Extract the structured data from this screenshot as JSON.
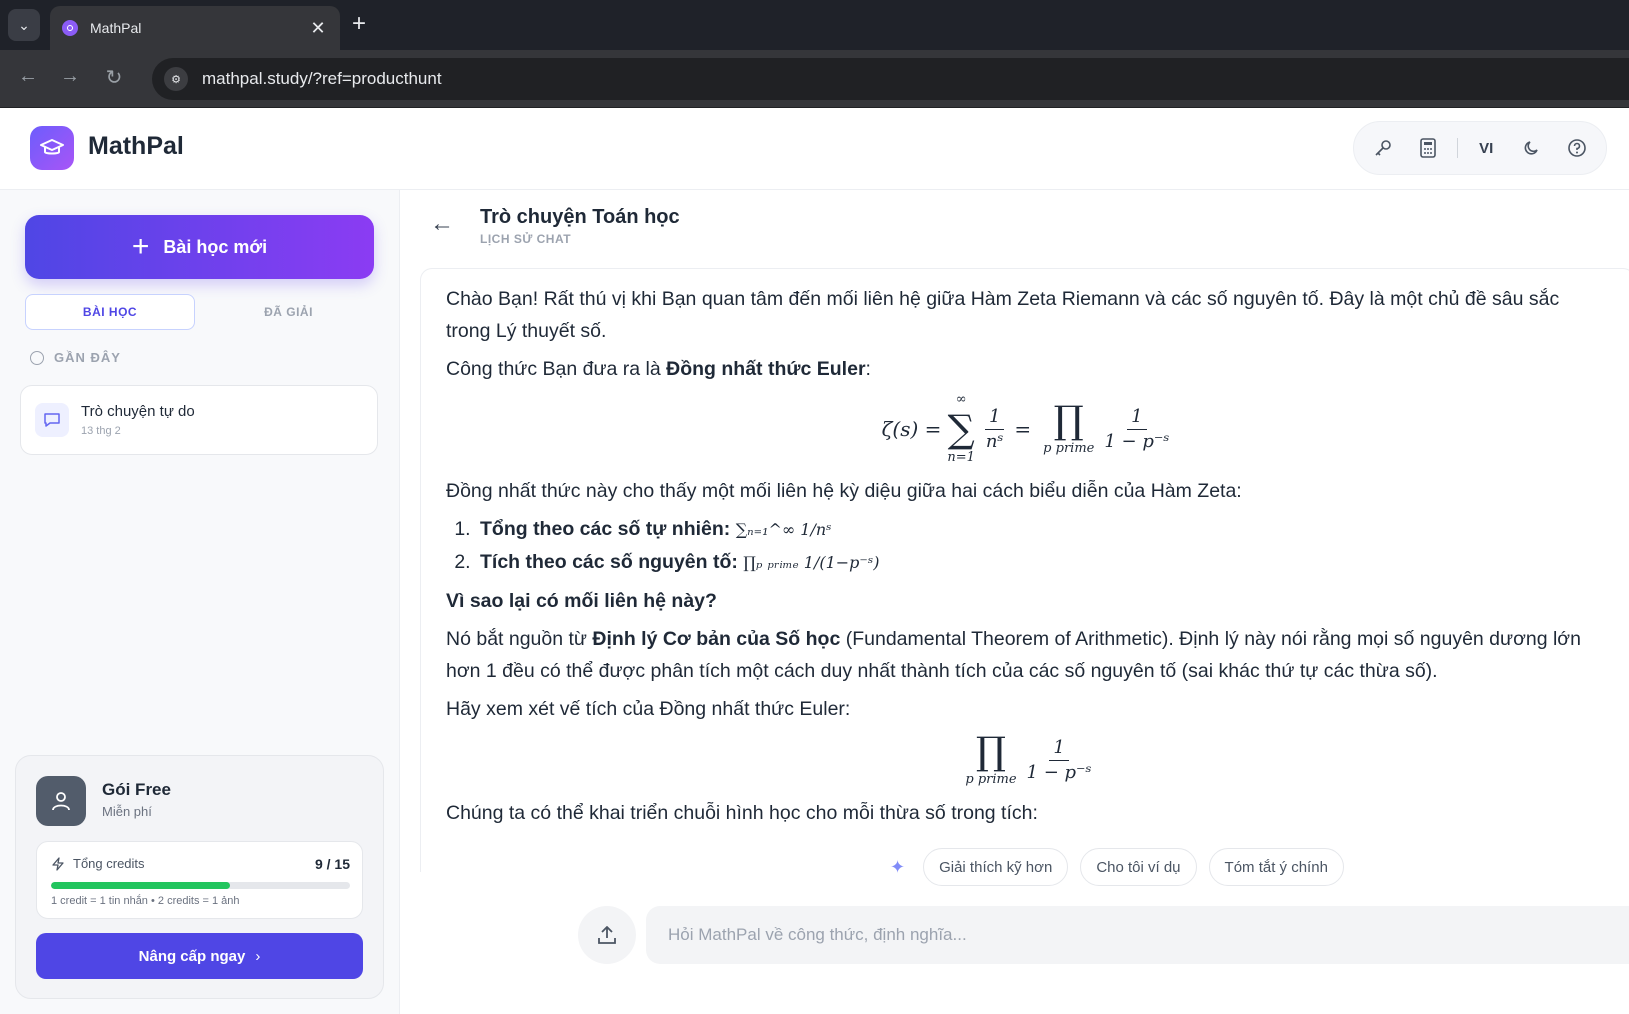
{
  "browser": {
    "tab_title": "MathPal",
    "url": "mathpal.study/?ref=producthunt"
  },
  "app": {
    "brand": "MathPal",
    "lang": "VI"
  },
  "sidebar": {
    "new_lesson": "Bài học mới",
    "tab_lessons": "BÀI HỌC",
    "tab_solved": "ĐÃ GIẢI",
    "recent_label": "GẦN ĐÂY",
    "chat_items": [
      {
        "name": "Trò chuyện tự do",
        "date": "13 thg 2"
      }
    ],
    "plan": {
      "name": "Gói Free",
      "sub": "Miễn phí",
      "credits_label": "Tổng credits",
      "credits_value": "9 / 15",
      "credits_fraction": 0.6,
      "note": "1 credit = 1 tin nhắn • 2 credits = 1 ảnh",
      "upgrade": "Nâng cấp ngay"
    }
  },
  "main": {
    "title": "Trò chuyện Toán học",
    "subtitle": "LỊCH SỬ CHAT",
    "msg": {
      "p1": "Chào Bạn! Rất thú vị khi Bạn quan tâm đến mối liên hệ giữa Hàm Zeta Riemann và các số nguyên tố. Đây là một chủ đề sâu sắc trong Lý thuyết số.",
      "p2a": "Công thức Bạn đưa ra là ",
      "p2b": "Đồng nhất thức Euler",
      "p2c": ":",
      "f1_lhs": "ζ(s) =",
      "sum_sup": "∞",
      "sum_sub": "n=1",
      "f1_num": "1",
      "f1_den": "nˢ",
      "prod_sub": "p prime",
      "f1_num2": "1",
      "f1_den2": "1 − p⁻ˢ",
      "p3": "Đồng nhất thức này cho thấy một mối liên hệ kỳ diệu giữa hai cách biểu diễn của Hàm Zeta:",
      "li1": "Tổng theo các số tự nhiên:",
      "li1_f": "∑ₙ₌₁^∞ 1/nˢ",
      "li2": "Tích theo các số nguyên tố:",
      "li2_f": "∏ₚ ₚᵣᵢₘₑ 1/(1−p⁻ˢ)",
      "h1": "Vì sao lại có mối liên hệ này?",
      "p4a": "Nó bắt nguồn từ ",
      "p4b": "Định lý Cơ bản của Số học",
      "p4c": " (Fundamental Theorem of Arithmetic). Định lý này nói rằng mọi số nguyên dương lớn hơn 1 đều có thể được phân tích một cách duy nhất thành tích của các số nguyên tố (sai khác thứ tự các thừa số).",
      "p5": "Hãy xem xét vế tích của Đồng nhất thức Euler:",
      "p6": "Chúng ta có thể khai triển chuỗi hình học cho mỗi thừa số trong tích:"
    },
    "suggestions": [
      "Giải thích kỹ hơn",
      "Cho tôi ví dụ",
      "Tóm tắt ý chính"
    ],
    "input_placeholder": "Hỏi MathPal về công thức, định nghĩa..."
  },
  "colors": {
    "accent": "#4f46e5",
    "progress": "#22c55e"
  }
}
